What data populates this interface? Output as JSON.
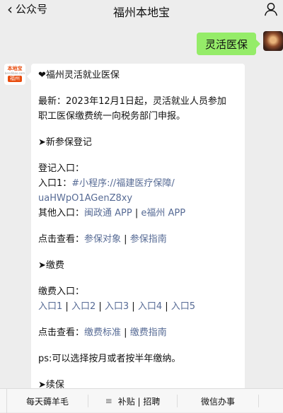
{
  "header": {
    "back_label": "公众号",
    "title": "福州本地宝"
  },
  "me": {
    "message": "灵活医保"
  },
  "bot": {
    "avatar_brand": "本地宝",
    "avatar_domain": "bendibao.com",
    "avatar_city": "福州",
    "heading": "❤福州灵活就业医保",
    "latest_line1": "最新：2023年12月1日起，灵活就业人员参加",
    "latest_line2": "职工医保缴费统一向税务部门申报。",
    "section_register": "➤新参保登记",
    "entry_heading": "登记入口：",
    "entry1_prefix": "入口1：",
    "entry1_link_a": "#小程序://福建医疗保障/",
    "entry1_link_b": "uaHWpO1AGenZ8xy",
    "other_prefix": "其他入口：",
    "other_link1": "闽政通 APP",
    "other_sep": " | ",
    "other_link2": "e福州 APP",
    "click_view": "点击查看：",
    "view_link1": "参保对象",
    "view_sep": "  |  ",
    "view_link2": "参保指南",
    "section_pay": "➤缴费",
    "pay_heading": "缴费入口：",
    "pay_link1": "入口1",
    "pay_sep1": "  |  ",
    "pay_link2": "入口2",
    "pay_sep2": " | ",
    "pay_link3": "入口3",
    "pay_sep3": "  |  ",
    "pay_link4": "入口4",
    "pay_sep4": "  |  ",
    "pay_link5": "入口5",
    "pay_view_link1": "缴费标准",
    "pay_view_link2": "缴费指南",
    "note": "ps:可以选择按月或者按半年缴纳。",
    "section_renew": "➤续保"
  },
  "bottom_menu": {
    "item1": "每天薅羊毛",
    "item2": "补贴 | 招聘",
    "item3": "微信办事"
  }
}
